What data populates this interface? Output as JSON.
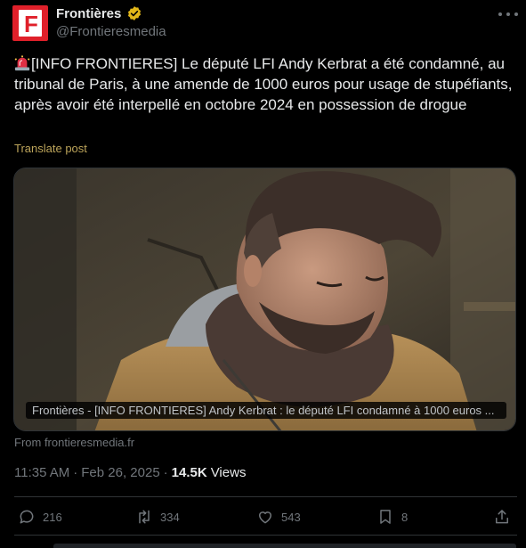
{
  "author": {
    "display_name": "Frontières",
    "handle": "@Frontieresmedia",
    "avatar_letter": "F",
    "verified": true,
    "brand_color": "#e0202a",
    "badge_color": "#e2b719"
  },
  "tweet": {
    "text": "[INFO FRONTIERES] Le député LFI Andy Kerbrat a été condamné, au tribunal de Paris, à une amende de 1000 euros pour usage de stupéfiants, après avoir été interpellé en octobre 2024 en possession de drogue",
    "emoji_icon": "siren-icon",
    "translate_label": "Translate post"
  },
  "media": {
    "caption": "Frontières - [INFO FRONTIERES] Andy Kerbrat : le député LFI condamné à 1000 euros ...",
    "source_label": "From frontieresmedia.fr"
  },
  "meta": {
    "time": "11:35 AM",
    "separator": "·",
    "date": "Feb 26, 2025",
    "separator2": "·",
    "views_count": "14.5K",
    "views_label": "Views"
  },
  "actions": {
    "replies": "216",
    "reposts": "334",
    "likes": "543",
    "bookmarks": "8"
  },
  "colors": {
    "background": "#000000",
    "text": "#e7e9ea",
    "muted": "#71767b",
    "divider": "#2f3336",
    "translate_link": "#bca45a"
  }
}
